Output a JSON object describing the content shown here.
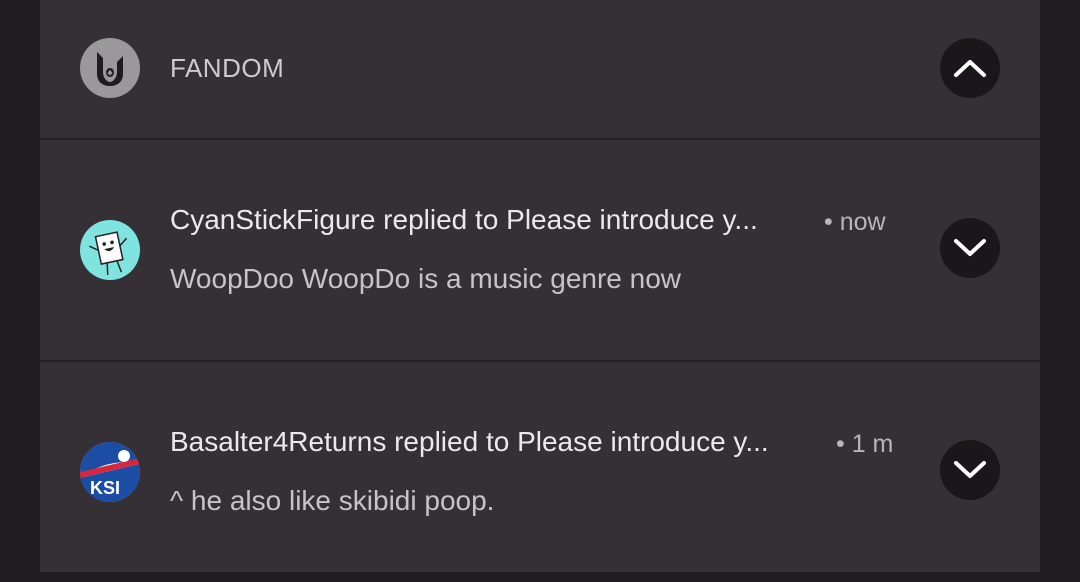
{
  "header": {
    "app_name": "FANDOM",
    "app_icon": "fandom-logo-icon",
    "toggle_icon": "chevron-up-icon"
  },
  "notifications": [
    {
      "avatar": "stick-figure-avatar",
      "title": "CyanStickFigure replied to Please introduce y...",
      "time": "• now",
      "body": "WoopDoo WoopDo is a music genre now",
      "expand_icon": "chevron-down-icon"
    },
    {
      "avatar": "ksi-logo-avatar",
      "title": "Basalter4Returns replied to Please introduce y...",
      "time": "• 1 m",
      "body": "^ he also like skibidi poop.",
      "expand_icon": "chevron-down-icon"
    }
  ],
  "colors": {
    "background": "#211c22",
    "card": "#343036",
    "button": "#1a1619"
  }
}
